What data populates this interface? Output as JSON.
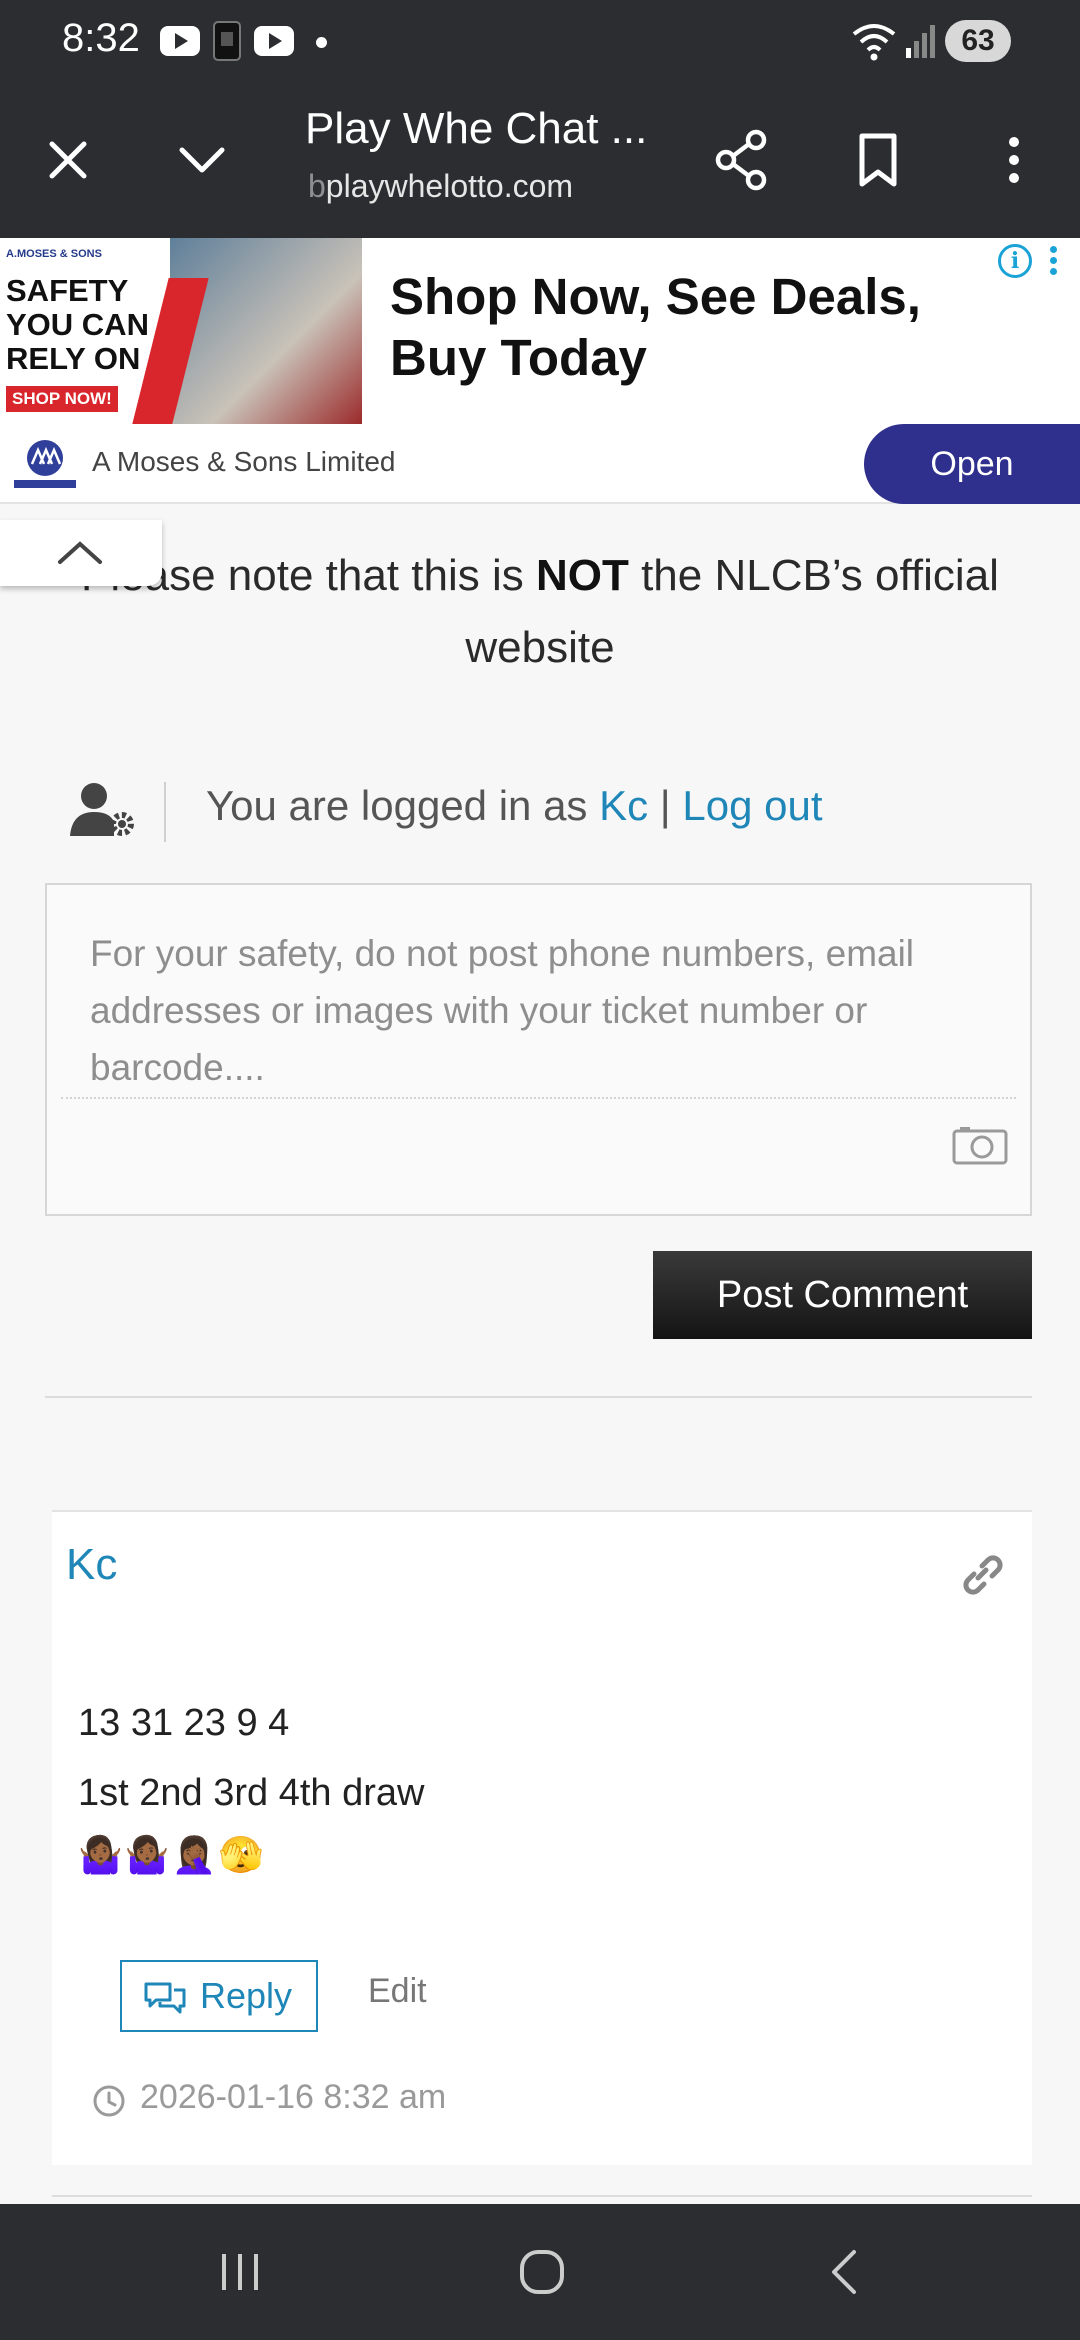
{
  "status_bar": {
    "time": "8:32",
    "battery": "63",
    "icons": [
      "youtube-icon",
      "sim-card-icon",
      "youtube-icon",
      "notification-dot",
      "wifi-icon",
      "signal-icon",
      "battery-icon"
    ]
  },
  "browser": {
    "title": "Play Whe Chat ...",
    "url_prefix": "b",
    "url": "playwhelotto.com",
    "icons": [
      "close-icon",
      "chevron-down-icon",
      "share-icon",
      "bookmark-icon",
      "more-vert-icon"
    ]
  },
  "ad": {
    "image": {
      "brand": "A.MOSES & SONS",
      "headline": "SAFETY YOU CAN RELY ON",
      "cta": "SHOP NOW!"
    },
    "headline": "Shop Now, See Deals, Buy Today",
    "company": "A Moses & Sons Limited",
    "open_label": "Open",
    "accent": "#2f2f8e"
  },
  "notice": {
    "before": "Please note that this is ",
    "bold": "NOT",
    "after": " the NLCB’s official website"
  },
  "login": {
    "prefix": "You are logged in as ",
    "user": "Kc",
    "separator": " | ",
    "logout": "Log out"
  },
  "comment_form": {
    "placeholder": "For your safety, do not post phone numbers, email addresses or images with your ticket number or barcode....",
    "submit_label": "Post Comment"
  },
  "comments": [
    {
      "author": "Kc",
      "lines": [
        "13 31 23 9 4",
        "1st 2nd 3rd 4th draw"
      ],
      "emoji": "🤷🏾‍♀️🤷🏾‍♀️🤦🏾‍♀️🫣",
      "reply_label": "Reply",
      "edit_label": "Edit",
      "date": "2026-01-16 8:32 am"
    }
  ],
  "colors": {
    "link": "#1f86b8",
    "dark_bar": "#2b2d31",
    "ad_button": "#2f2f8e"
  }
}
